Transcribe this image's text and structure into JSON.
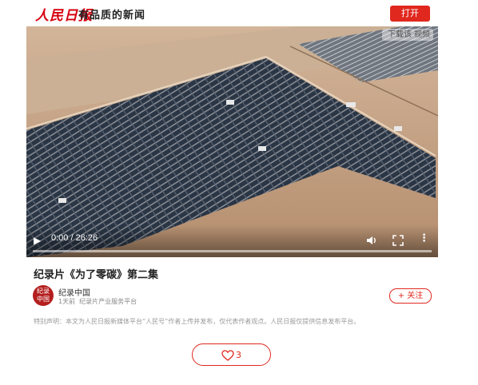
{
  "header": {
    "logo_text": "人民日报",
    "slogan": "有品质的新闻",
    "open_button": "打开",
    "brand_color": "#e0281e"
  },
  "video": {
    "download_label": "下载该",
    "download_suffix": "视频",
    "current_time": "0:00",
    "separator": "/",
    "duration": "26:26",
    "progress": 0,
    "icons": [
      "play-icon",
      "volume-icon",
      "fullscreen-icon",
      "more-icon"
    ]
  },
  "article": {
    "title": "纪录片《为了零碳》第二集",
    "author": "纪录中国",
    "avatar_line1": "纪录",
    "avatar_line2": "中国",
    "time_ago": "1天前",
    "source_desc": "纪录片产业服务平台",
    "follow_label": "+ 关注",
    "notice": "特别声明：本文为人民日报新媒体平台“人民号”作者上传并发布，仅代表作者观点。人民日报仅提供信息发布平台。",
    "like_count": "3"
  }
}
